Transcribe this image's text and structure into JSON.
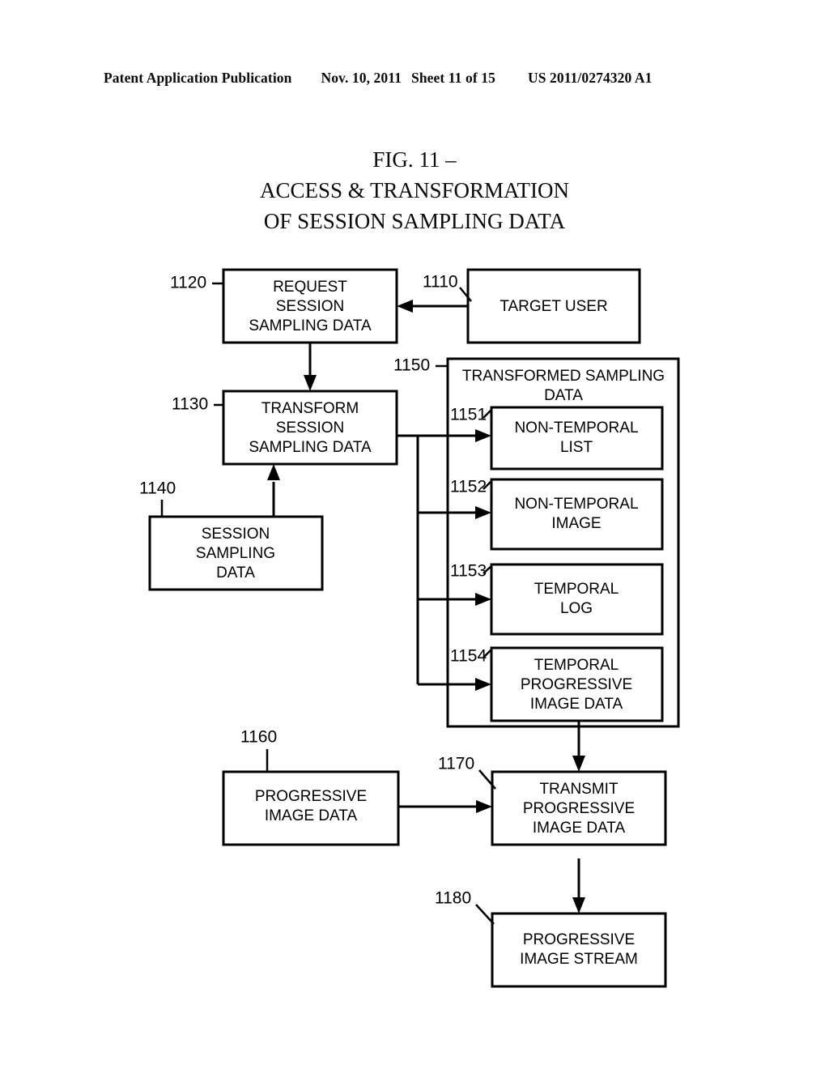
{
  "header": {
    "publication": "Patent Application Publication",
    "date": "Nov. 10, 2011",
    "sheet": "Sheet 11 of 15",
    "number": "US 2011/0274320 A1"
  },
  "figure": {
    "title_line1": "FIG. 11 –",
    "title_line2": "ACCESS & TRANSFORMATION",
    "title_line3": "OF SESSION SAMPLING DATA"
  },
  "diagram": {
    "type": "flowchart",
    "nodes": [
      {
        "ref": "1120",
        "name": "request-session-sampling-data",
        "lines": [
          "REQUEST",
          "SESSION",
          "SAMPLING DATA"
        ]
      },
      {
        "ref": "1110",
        "name": "target-user",
        "lines": [
          "TARGET USER"
        ]
      },
      {
        "ref": "1130",
        "name": "transform-session-sampling-data",
        "lines": [
          "TRANSFORM",
          "SESSION",
          "SAMPLING DATA"
        ]
      },
      {
        "ref": "1140",
        "name": "session-sampling-data",
        "lines": [
          "SESSION",
          "SAMPLING",
          "DATA"
        ]
      },
      {
        "ref": "1150",
        "name": "transformed-sampling-data-group",
        "lines": [
          "TRANSFORMED SAMPLING",
          "DATA"
        ]
      },
      {
        "ref": "1151",
        "name": "non-temporal-list",
        "lines": [
          "NON-TEMPORAL",
          "LIST"
        ]
      },
      {
        "ref": "1152",
        "name": "non-temporal-image",
        "lines": [
          "NON-TEMPORAL",
          "IMAGE"
        ]
      },
      {
        "ref": "1153",
        "name": "temporal-log",
        "lines": [
          "TEMPORAL",
          "LOG"
        ]
      },
      {
        "ref": "1154",
        "name": "temporal-progressive-image-data",
        "lines": [
          "TEMPORAL",
          "PROGRESSIVE",
          "IMAGE DATA"
        ]
      },
      {
        "ref": "1160",
        "name": "progressive-image-data",
        "lines": [
          "PROGRESSIVE",
          "IMAGE DATA"
        ]
      },
      {
        "ref": "1170",
        "name": "transmit-progressive-image-data",
        "lines": [
          "TRANSMIT",
          "PROGRESSIVE",
          "IMAGE DATA"
        ]
      },
      {
        "ref": "1180",
        "name": "progressive-image-stream",
        "lines": [
          "PROGRESSIVE",
          "IMAGE STREAM"
        ]
      }
    ],
    "edges": [
      {
        "from": "1110",
        "to": "1120"
      },
      {
        "from": "1120",
        "to": "1130"
      },
      {
        "from": "1140",
        "to": "1130"
      },
      {
        "from": "1130",
        "to": "1151"
      },
      {
        "from": "1130",
        "to": "1152"
      },
      {
        "from": "1130",
        "to": "1153"
      },
      {
        "from": "1130",
        "to": "1154"
      },
      {
        "from": "1154",
        "to": "1170"
      },
      {
        "from": "1160",
        "to": "1170"
      },
      {
        "from": "1170",
        "to": "1180"
      }
    ]
  },
  "colors": {
    "ink": "#000000",
    "paper": "#ffffff"
  }
}
